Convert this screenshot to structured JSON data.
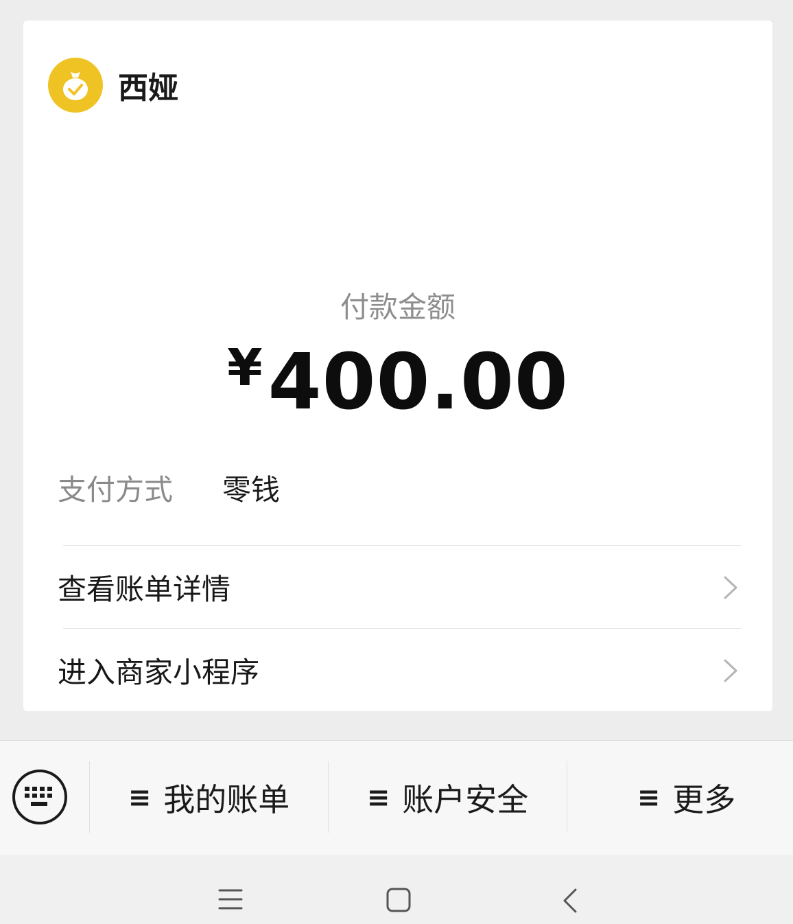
{
  "merchant": {
    "name": "西娅",
    "logo_icon": "money-bag-check-icon",
    "logo_color": "#eec323"
  },
  "payment": {
    "amount_label": "付款金额",
    "currency_symbol": "¥",
    "amount": "400.00",
    "method_label": "支付方式",
    "method_value": "零钱"
  },
  "rows": [
    {
      "label": "查看账单详情",
      "icon": "chevron-right-icon"
    },
    {
      "label": "进入商家小程序",
      "icon": "chevron-right-icon"
    }
  ],
  "menu": {
    "keyboard_icon": "keyboard-icon",
    "items": [
      {
        "icon": "≡",
        "label": "我的账单"
      },
      {
        "icon": "≡",
        "label": "账户安全"
      },
      {
        "icon": "≡",
        "label": "更多"
      }
    ]
  },
  "system_nav": {
    "menu_icon": "hamburger-icon",
    "home_icon": "square-home-icon",
    "back_icon": "back-chevron-icon"
  }
}
